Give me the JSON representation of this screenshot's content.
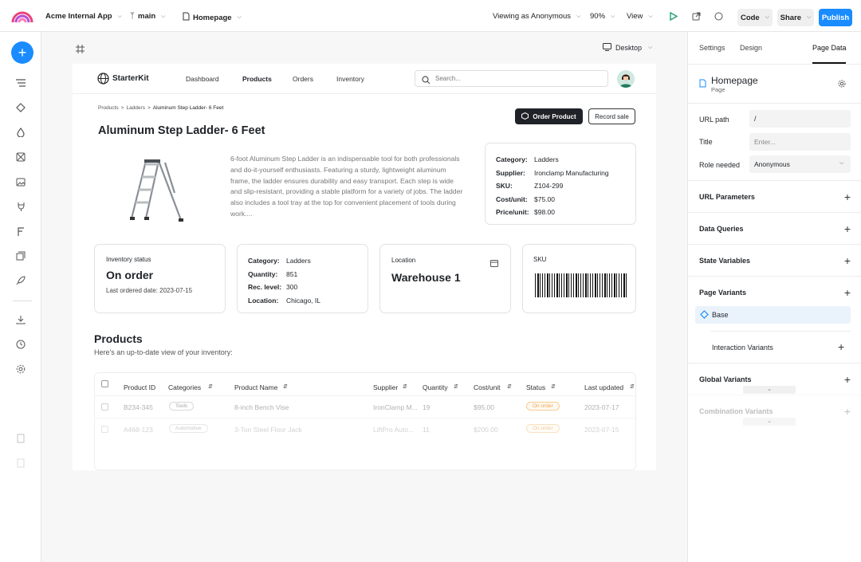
{
  "topbar": {
    "app_name": "Acme Internal App",
    "branch": "main",
    "page": "Homepage",
    "viewing_as": "Viewing as Anonymous",
    "zoom": "90%",
    "view": "View",
    "code": "Code",
    "share": "Share",
    "publish": "Publish"
  },
  "canvas": {
    "device": "Desktop"
  },
  "app": {
    "brand": "StarterKit",
    "nav": [
      "Dashboard",
      "Products",
      "Orders",
      "Inventory"
    ],
    "search_placeholder": "Search...",
    "breadcrumb": {
      "a": "Products",
      "sep1": ">",
      "b": "Ladders",
      "sep2": ">",
      "c": "Aluminum Step Ladder- 6 Feet"
    },
    "order_button": "Order Product",
    "record_button": "Record sale",
    "title": "Aluminum Step Ladder- 6 Feet",
    "description": "6-foot Aluminum Step Ladder is an indispensable tool for both professionals and do-it-yourself enthusiasts. Featuring a sturdy, lightweight aluminum frame, the ladder ensures durability and easy transport. Each step is wide and slip-resistant, providing a stable platform for a variety of jobs. The ladder also includes a tool tray at the top for convenient placement of tools during work....",
    "details": [
      {
        "k": "Category:",
        "v": "Ladders"
      },
      {
        "k": "Supplier:",
        "v": "Ironclamp Manufacturing"
      },
      {
        "k": "SKU:",
        "v": "Z104-299"
      },
      {
        "k": "Cost/unit:",
        "v": "$75.00"
      },
      {
        "k": "Price/unit:",
        "v": "$98.00"
      }
    ],
    "inventory": {
      "label": "Inventory status",
      "status": "On order",
      "last_ordered": "Last ordered date: 2023-07-15"
    },
    "stock": [
      {
        "k": "Category:",
        "v": "Ladders"
      },
      {
        "k": "Quantity:",
        "v": "851"
      },
      {
        "k": "Rec. level:",
        "v": "300"
      },
      {
        "k": "Location:",
        "v": "Chicago, IL"
      }
    ],
    "location": {
      "label": "Location",
      "value": "Warehouse 1"
    },
    "sku_label": "SKU",
    "products": {
      "title": "Products",
      "subtitle": "Here's an up-to-date view of your inventory:",
      "columns": [
        "Product ID",
        "Categories",
        "Product Name",
        "Supplier",
        "Quantity",
        "Cost/unit",
        "Status",
        "Last updated"
      ],
      "rows": [
        {
          "id": "B234-345",
          "category": "Tools",
          "name": "8-inch Bench Vise",
          "supplier": "IronClamp M...",
          "qty": "19",
          "cost": "$95.00",
          "status": "On order",
          "updated": "2023-07-17"
        },
        {
          "id": "A468-123",
          "category": "Automotive",
          "name": "3-Ton Steel Floor Jack",
          "supplier": "LiftPro Auto...",
          "qty": "11",
          "cost": "$200.00",
          "status": "On order",
          "updated": "2023-07-15"
        }
      ]
    }
  },
  "panel": {
    "tabs": [
      "Settings",
      "Design",
      "Page Data"
    ],
    "page_title": "Homepage",
    "page_subtitle": "Page",
    "url_path_label": "URL path",
    "url_path_value": "/",
    "title_label": "Title",
    "title_placeholder": "Enter...",
    "role_label": "Role needed",
    "role_value": "Anonymous",
    "sections": {
      "url_params": "URL Parameters",
      "data_queries": "Data Queries",
      "state_vars": "State Variables",
      "page_variants": "Page Variants",
      "base": "Base",
      "interaction_variants": "Interaction Variants",
      "global_variants": "Global Variants",
      "combination_variants": "Combination Variants"
    }
  },
  "colors": {
    "accent": "#1a8cff",
    "green": "#22a06b"
  }
}
